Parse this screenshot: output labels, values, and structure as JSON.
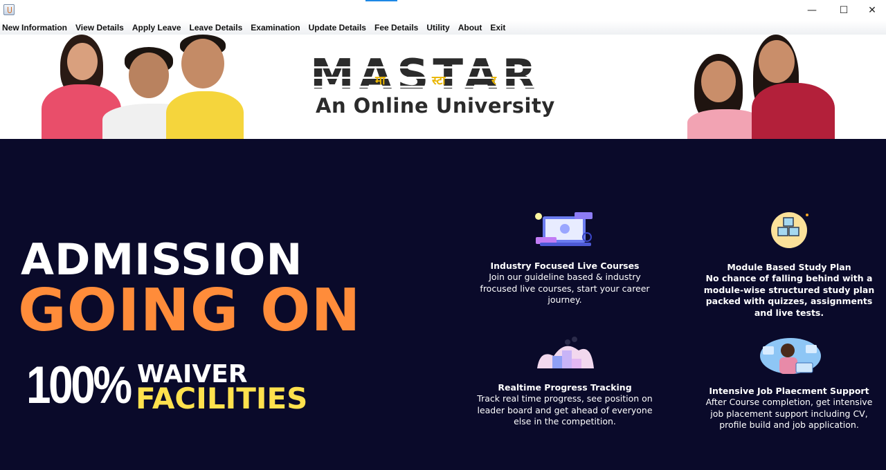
{
  "window": {
    "controls": {
      "minimize": "—",
      "maximize": "☐",
      "close": "✕"
    },
    "accent_color": "#1e88e5"
  },
  "menu": {
    "items": [
      {
        "id": "new-information",
        "label": "New Information"
      },
      {
        "id": "view-details",
        "label": "View Details"
      },
      {
        "id": "apply-leave",
        "label": "Apply Leave"
      },
      {
        "id": "leave-details",
        "label": "Leave Details"
      },
      {
        "id": "examination",
        "label": "Examination"
      },
      {
        "id": "update-details",
        "label": "Update Details"
      },
      {
        "id": "fee-details",
        "label": "Fee Details"
      },
      {
        "id": "utility",
        "label": "Utility"
      },
      {
        "id": "about",
        "label": "About"
      },
      {
        "id": "exit",
        "label": "Exit"
      }
    ]
  },
  "banner": {
    "logo_word": "MASTAR",
    "logo_syllables": [
      "मा",
      "स्टा",
      "र"
    ],
    "tagline": "An Online University"
  },
  "promo": {
    "headline_1": "ADMISSION",
    "headline_2": "GOING ON",
    "percent": "100%",
    "waiver": "WAIVER",
    "facilities": "FACILITIES",
    "colors": {
      "background": "#0a0a2a",
      "orange": "#ff8c3a",
      "yellow": "#ffe14d"
    }
  },
  "features": [
    {
      "title": "Industry Focused Live Courses",
      "desc": "Join our guideline based & industry frocused live courses, start your career journey.",
      "icon": "laptop-course-icon"
    },
    {
      "title": "Module Based Study Plan",
      "desc": "No chance of falling behind with a module-wise structured study plan packed with quizzes, assignments and live tests.",
      "icon": "modules-cubes-icon"
    },
    {
      "title": "Realtime Progress Tracking",
      "desc": "Track real time progress, see position on leader board and get ahead of everyone else in the competition.",
      "icon": "progress-podium-icon"
    },
    {
      "title": "Intensive Job Plaecment Support",
      "desc": "After Course completion, get intensive job placement support including CV, profile build and job application.",
      "icon": "job-support-icon"
    }
  ]
}
